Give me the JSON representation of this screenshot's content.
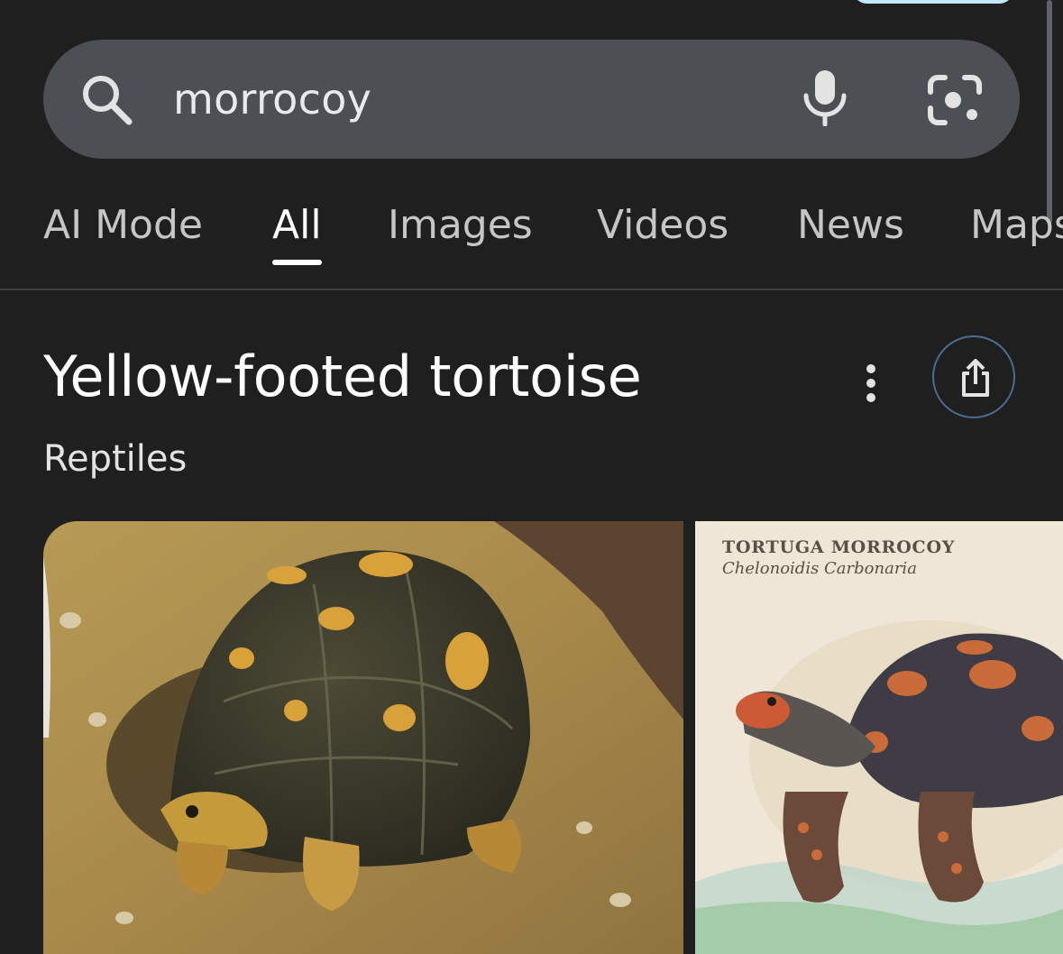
{
  "search": {
    "query": "morrocoy"
  },
  "tabs": [
    {
      "label": "AI Mode"
    },
    {
      "label": "All"
    },
    {
      "label": "Images"
    },
    {
      "label": "Videos"
    },
    {
      "label": "News"
    },
    {
      "label": "Maps"
    }
  ],
  "active_tab": "All",
  "knowledge_panel": {
    "title": "Yellow-footed tortoise",
    "subtitle": "Reptiles"
  },
  "images": [
    {
      "description_icon": "tortoise-photo"
    },
    {
      "title": "TORTUGA MORROCOY",
      "subtitle": "Chelonoidis Carbonaria"
    }
  ],
  "colors": {
    "background": "#1f1f1f",
    "search_bar": "#4c5055",
    "share_ring": "#4a6d93",
    "top_pill": "#c2e7ff"
  }
}
